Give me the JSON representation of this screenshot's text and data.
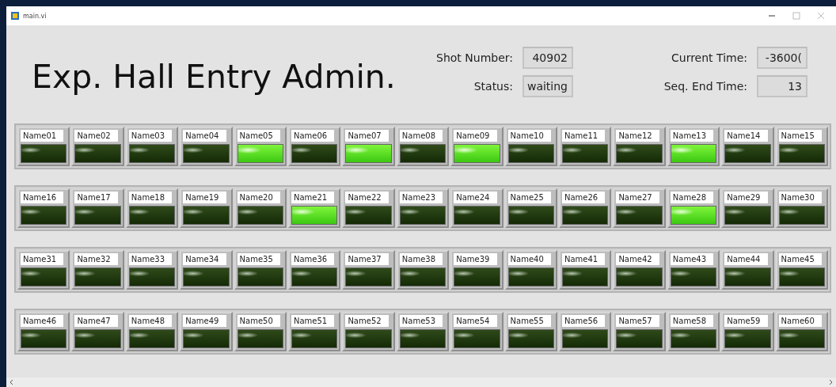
{
  "window": {
    "title": "main.vi"
  },
  "heading": "Exp. Hall Entry Admin.",
  "fields": [
    {
      "label": "Shot Number:",
      "value": "40902"
    },
    {
      "label": "Current Time:",
      "value": "-3600("
    },
    {
      "label": "Status:",
      "value": "waiting"
    },
    {
      "label": "Seq. End Time:",
      "value": "13"
    }
  ],
  "indicator_rows": [
    {
      "indicators": [
        {
          "name": "Name01",
          "on": false
        },
        {
          "name": "Name02",
          "on": false
        },
        {
          "name": "Name03",
          "on": false
        },
        {
          "name": "Name04",
          "on": false
        },
        {
          "name": "Name05",
          "on": true
        },
        {
          "name": "Name06",
          "on": false
        },
        {
          "name": "Name07",
          "on": true
        },
        {
          "name": "Name08",
          "on": false
        },
        {
          "name": "Name09",
          "on": true
        },
        {
          "name": "Name10",
          "on": false
        },
        {
          "name": "Name11",
          "on": false
        },
        {
          "name": "Name12",
          "on": false
        },
        {
          "name": "Name13",
          "on": true
        },
        {
          "name": "Name14",
          "on": false
        },
        {
          "name": "Name15",
          "on": false
        }
      ]
    },
    {
      "indicators": [
        {
          "name": "Name16",
          "on": false
        },
        {
          "name": "Name17",
          "on": false
        },
        {
          "name": "Name18",
          "on": false
        },
        {
          "name": "Name19",
          "on": false
        },
        {
          "name": "Name20",
          "on": false
        },
        {
          "name": "Name21",
          "on": true
        },
        {
          "name": "Name22",
          "on": false
        },
        {
          "name": "Name23",
          "on": false
        },
        {
          "name": "Name24",
          "on": false
        },
        {
          "name": "Name25",
          "on": false
        },
        {
          "name": "Name26",
          "on": false
        },
        {
          "name": "Name27",
          "on": false
        },
        {
          "name": "Name28",
          "on": true
        },
        {
          "name": "Name29",
          "on": false
        },
        {
          "name": "Name30",
          "on": false
        }
      ]
    },
    {
      "indicators": [
        {
          "name": "Name31",
          "on": false
        },
        {
          "name": "Name32",
          "on": false
        },
        {
          "name": "Name33",
          "on": false
        },
        {
          "name": "Name34",
          "on": false
        },
        {
          "name": "Name35",
          "on": false
        },
        {
          "name": "Name36",
          "on": false
        },
        {
          "name": "Name37",
          "on": false
        },
        {
          "name": "Name38",
          "on": false
        },
        {
          "name": "Name39",
          "on": false
        },
        {
          "name": "Name40",
          "on": false
        },
        {
          "name": "Name41",
          "on": false
        },
        {
          "name": "Name42",
          "on": false
        },
        {
          "name": "Name43",
          "on": false
        },
        {
          "name": "Name44",
          "on": false
        },
        {
          "name": "Name45",
          "on": false
        }
      ]
    },
    {
      "indicators": [
        {
          "name": "Name46",
          "on": false
        },
        {
          "name": "Name47",
          "on": false
        },
        {
          "name": "Name48",
          "on": false
        },
        {
          "name": "Name49",
          "on": false
        },
        {
          "name": "Name50",
          "on": false
        },
        {
          "name": "Name51",
          "on": false
        },
        {
          "name": "Name52",
          "on": false
        },
        {
          "name": "Name53",
          "on": false
        },
        {
          "name": "Name54",
          "on": false
        },
        {
          "name": "Name55",
          "on": false
        },
        {
          "name": "Name56",
          "on": false
        },
        {
          "name": "Name57",
          "on": false
        },
        {
          "name": "Name58",
          "on": false
        },
        {
          "name": "Name59",
          "on": false
        },
        {
          "name": "Name60",
          "on": false
        }
      ]
    }
  ]
}
